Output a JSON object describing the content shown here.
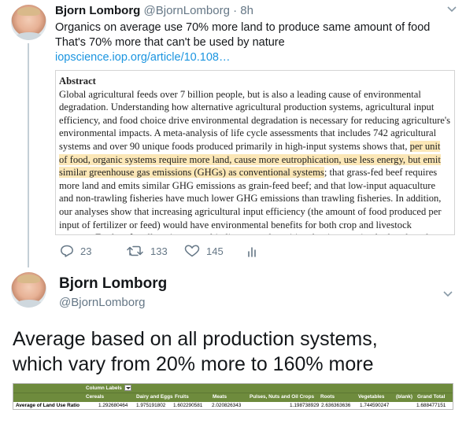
{
  "tweet1": {
    "author_name": "Bjorn Lomborg",
    "handle": "@BjornLomborg",
    "separator": "·",
    "time": "8h",
    "text_lines": [
      "Organics on average use 70% more land to produce same amount of food",
      "That's 70% more that can't be used by nature"
    ],
    "link": "iopscience.iop.org/article/10.108…",
    "abstract": {
      "title": "Abstract",
      "lines": [
        [
          {
            "t": "Global agricultural feeds over 7 billion people, but is also a leading cause of environmental",
            "h": false
          }
        ],
        [
          {
            "t": "degradation. Understanding how alternative agricultural production systems, agricultural input",
            "h": false
          }
        ],
        [
          {
            "t": "efficiency, and food choice drive environmental degradation is necessary for reducing agriculture's",
            "h": false
          }
        ],
        [
          {
            "t": "environmental impacts. A meta-analysis of life cycle assessments that includes 742 agricultural",
            "h": false
          }
        ],
        [
          {
            "t": "systems and over 90 unique foods produced primarily in high-input systems shows that, ",
            "h": false
          },
          {
            "t": "per unit",
            "h": true
          }
        ],
        [
          {
            "t": "of food, organic systems require more land, cause more eutrophication, use less energy, but emit",
            "h": true
          }
        ],
        [
          {
            "t": "similar greenhouse gas emissions (GHGs) as conventional systems",
            "h": true
          },
          {
            "t": "; that grass-fed beef requires",
            "h": false
          }
        ],
        [
          {
            "t": "more land and emits similar GHG emissions as grain-feed beef; and that low-input aquaculture",
            "h": false
          }
        ],
        [
          {
            "t": "and non-trawling fisheries have much lower GHG emissions than trawling fisheries. In addition,",
            "h": false
          }
        ],
        [
          {
            "t": "our analyses show that increasing agricultural input efficiency (the amount of food produced per",
            "h": false
          }
        ],
        [
          {
            "t": "input of fertilizer or feed) would have environmental benefits for both crop and livestock",
            "h": false
          }
        ],
        [
          {
            "t": "systems. Further, for all environmental indicators and nutritional units examined, plant-based",
            "h": false
          }
        ]
      ]
    },
    "actions": {
      "replies": "23",
      "retweets": "133",
      "likes": "145"
    }
  },
  "tweet2": {
    "author_name": "Bjorn Lomborg",
    "handle": "@BjornLomborg",
    "text_lines": [
      "Average based on all production systems,",
      "which vary from 20% more to 160% more"
    ],
    "pivot": {
      "column_labels": "Column Labels",
      "headers": [
        "Cereals",
        "Dairy and Eggs",
        "Fruits",
        "Meats",
        "Pulses, Nuts and Oil Crops",
        "Roots",
        "Vegetables",
        "(blank)",
        "Grand Total"
      ],
      "row_label": "Average of Land Use Ratio",
      "values": [
        "1.292680464",
        "1.975191802",
        "1.602290581",
        "2.020826343",
        "",
        "1.198738929",
        "2.636363636",
        "1.744590247",
        "",
        "1.688477151"
      ]
    }
  },
  "icons": {
    "reply": "reply-icon",
    "retweet": "retweet-icon",
    "like": "heart-icon",
    "analytics": "analytics-icon",
    "menu": "chevron-down-icon"
  },
  "colors": {
    "link": "#1b95e0",
    "muted": "#657786",
    "highlight": "#fbe7b7",
    "pivot_header": "#6e8b3d"
  }
}
